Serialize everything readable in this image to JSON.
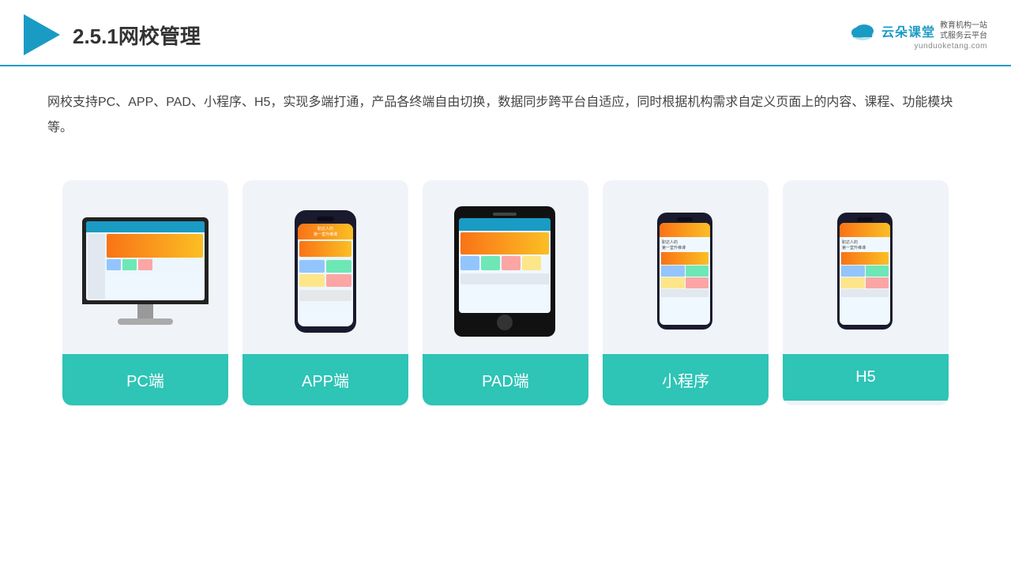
{
  "header": {
    "title": "2.5.1网校管理",
    "brand": {
      "name": "云朵课堂",
      "url": "yunduoketang.com",
      "tagline": "教育机构一站\n式服务云平台"
    }
  },
  "description": "网校支持PC、APP、PAD、小程序、H5，实现多端打通，产品各终端自由切换，数据同步跨平台自适应，同时根据机构需求自定义页面上的内容、课程、功能模块等。",
  "cards": [
    {
      "id": "pc",
      "label": "PC端"
    },
    {
      "id": "app",
      "label": "APP端"
    },
    {
      "id": "pad",
      "label": "PAD端"
    },
    {
      "id": "miniapp",
      "label": "小程序"
    },
    {
      "id": "h5",
      "label": "H5"
    }
  ],
  "colors": {
    "accent": "#1a9bc4",
    "teal": "#2ec4b6",
    "bg_card": "#f0f4f9"
  }
}
